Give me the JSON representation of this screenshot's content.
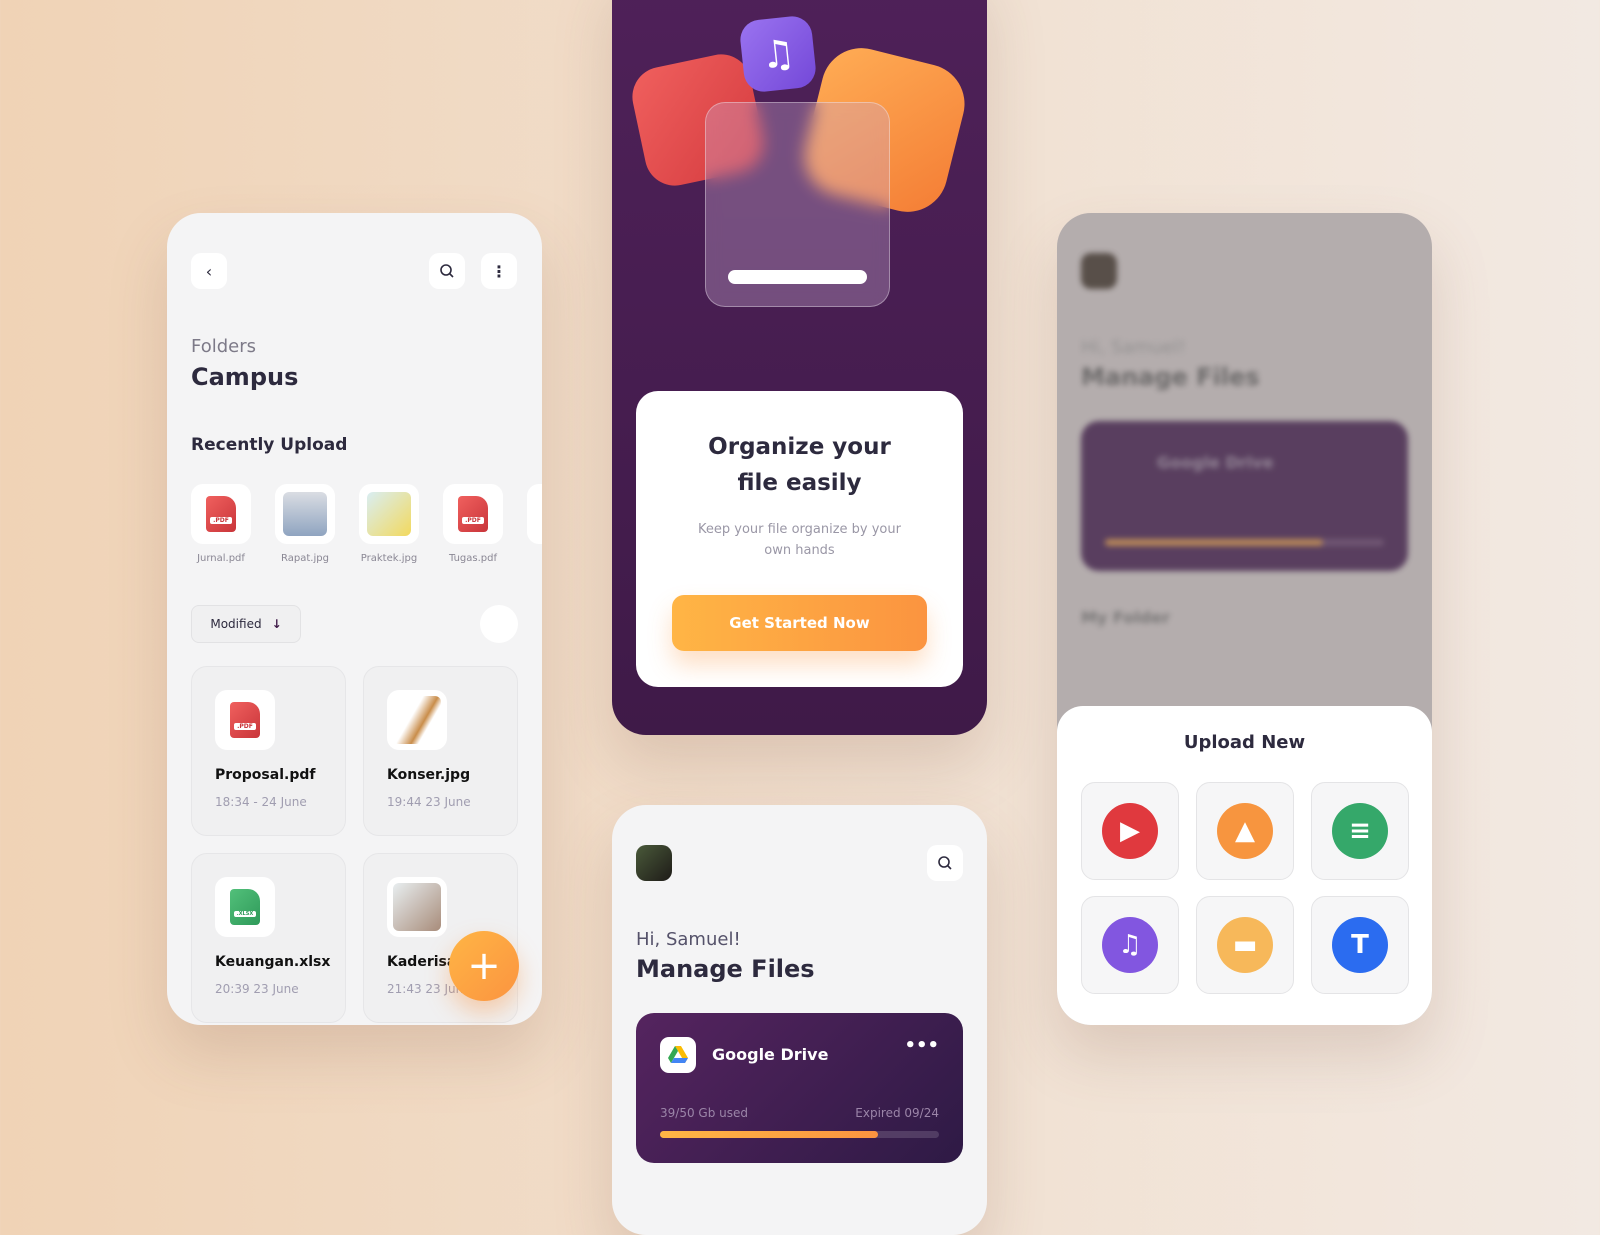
{
  "folder": {
    "crumb": "Folders",
    "title": "Campus",
    "recent_title": "Recently Upload",
    "recent": [
      {
        "name": "Jurnal.pdf",
        "type": "pdf"
      },
      {
        "name": "Rapat.jpg",
        "type": "image"
      },
      {
        "name": "Praktek.jpg",
        "type": "image"
      },
      {
        "name": "Tugas.pdf",
        "type": "pdf"
      }
    ],
    "sort_label": "Modified",
    "files": [
      {
        "name": "Proposal.pdf",
        "date": "18:34 - 24 June",
        "type": "pdf"
      },
      {
        "name": "Konser.jpg",
        "date": "19:44 23 June",
        "type": "image"
      },
      {
        "name": "Keuangan.xlsx",
        "date": "20:39 23 June",
        "type": "xlsx"
      },
      {
        "name": "Kaderisasi.jpg",
        "date": "21:43 23 June",
        "type": "image"
      }
    ],
    "pdf_tag": ".PDF",
    "xlsx_tag": ".XLSX"
  },
  "onboarding": {
    "title": "Organize your file easily",
    "subtitle": "Keep your file organize by your own hands",
    "cta": "Get Started Now"
  },
  "home": {
    "greeting": "Hi, Samuel!",
    "title": "Manage Files",
    "drive": {
      "name": "Google Drive",
      "usage": "39/50 Gb used",
      "expiry": "Expired 09/24",
      "used_fraction": 0.78
    },
    "my_folder": "My Folder"
  },
  "upload": {
    "title": "Upload New",
    "options": [
      {
        "icon": "video-icon",
        "color": "#e0393e"
      },
      {
        "icon": "image-icon",
        "color": "#f7953f"
      },
      {
        "icon": "document-icon",
        "color": "#35a86a"
      },
      {
        "icon": "music-icon",
        "color": "#8256e0"
      },
      {
        "icon": "folder-icon",
        "color": "#f7b85a"
      },
      {
        "icon": "text-icon",
        "color": "#2b6cf0"
      }
    ]
  },
  "colors": {
    "accent": "#ffa23f",
    "purple": "#4a1f55"
  }
}
